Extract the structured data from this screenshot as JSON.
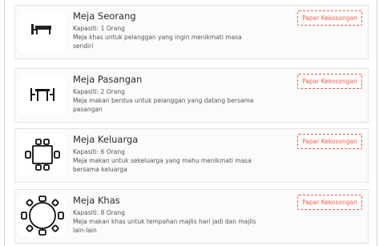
{
  "tables": [
    {
      "name": "Meja Seorang",
      "capacity": "Kapasiti: 1 Orang",
      "description": "Meja khas untuk pelanggan yang ingin menikmati masa sendiri",
      "button_label": "Papar Kekosongan",
      "icon": "single-desk-icon"
    },
    {
      "name": "Meja Pasangan",
      "capacity": "Kapasiti: 2 Orang",
      "description": "Meja makan berdua untuk pelanggan yang datang bersama pasangan",
      "button_label": "Papar Kekosongan",
      "icon": "two-seat-table-icon"
    },
    {
      "name": "Meja Keluarga",
      "capacity": "Kapasiti: 6 Orang",
      "description": "Meja makan untuk sekeluarga yang mahu menikmati masa bersama keluarga",
      "button_label": "Papar Kekosongan",
      "icon": "six-seat-table-icon"
    },
    {
      "name": "Meja Khas",
      "capacity": "Kapasiti: 8 Orang",
      "description": "Meja makan khas untuk tempahan majlis hari jadi dan majlis lain-lain",
      "button_label": "Papar Kekosongan",
      "icon": "round-table-icon"
    }
  ],
  "colors": {
    "accent": "#f25a4a",
    "card_bg": "#fbfbfb",
    "card_border": "#e3e3e3"
  }
}
